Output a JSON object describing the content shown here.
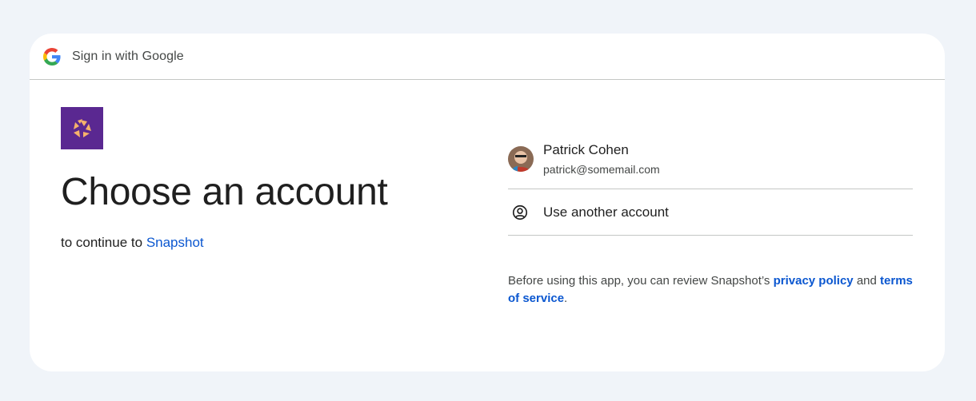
{
  "header": {
    "title": "Sign in with Google",
    "logo_icon": "google-g-icon"
  },
  "app": {
    "logo_icon": "snapshot-app-icon",
    "logo_color": "#5a2891",
    "name": "Snapshot"
  },
  "main": {
    "heading": "Choose an account",
    "subline_prefix": "to continue to",
    "app_link": "Snapshot"
  },
  "accounts": [
    {
      "name": "Patrick Cohen",
      "email": "patrick@somemail.com",
      "avatar_icon": "user-avatar"
    }
  ],
  "use_another": {
    "label": "Use another account",
    "icon": "person-circle-icon"
  },
  "policy": {
    "prefix": "Before using this app, you can review Snapshot’s",
    "privacy_link": "privacy policy",
    "middle": "and",
    "terms_link": "terms of service",
    "suffix": "."
  },
  "colors": {
    "link": "#0b57d0",
    "background": "#f0f4f9",
    "card": "#ffffff",
    "divider": "#c4c7c5"
  }
}
